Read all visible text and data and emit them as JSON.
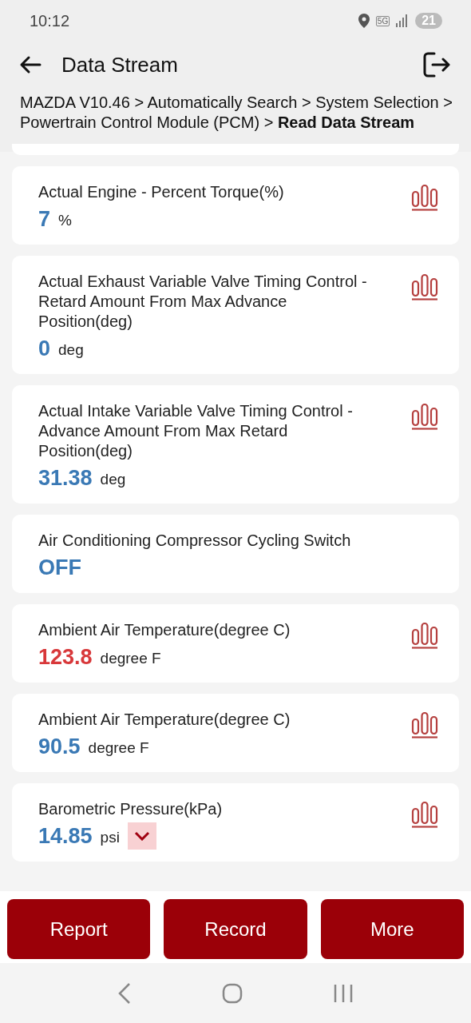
{
  "status_bar": {
    "time": "10:12",
    "network": "5G",
    "battery": "21"
  },
  "header": {
    "title": "Data Stream"
  },
  "breadcrumb": "MAZDA V10.46 > Automatically Search > System Selection > Powertrain Control Module (PCM) > **Read Data Stream**",
  "items": [
    {
      "name": "Actual Engine - Percent Torque(%)",
      "value": "7",
      "unit": "%",
      "alarm": false,
      "has_chart": true,
      "unit_dropdown": false
    },
    {
      "name": "Actual Exhaust Variable Valve Timing Control - Retard Amount From Max Advance Position(deg)",
      "value": "0",
      "unit": "deg",
      "alarm": false,
      "has_chart": true,
      "unit_dropdown": false
    },
    {
      "name": "Actual Intake Variable Valve Timing Control - Advance Amount From Max Retard Position(deg)",
      "value": "31.38",
      "unit": "deg",
      "alarm": false,
      "has_chart": true,
      "unit_dropdown": false
    },
    {
      "name": "Air Conditioning Compressor Cycling Switch",
      "value": "OFF",
      "alarm": false,
      "has_chart": false,
      "unit_dropdown": false
    },
    {
      "name": "Ambient Air Temperature(degree C)",
      "value": "123.8",
      "unit": "degree F",
      "alarm": true,
      "has_chart": true,
      "unit_dropdown": false
    },
    {
      "name": "Ambient Air Temperature(degree C)",
      "value": "90.5",
      "unit": "degree F",
      "alarm": false,
      "has_chart": true,
      "unit_dropdown": false
    },
    {
      "name": "Barometric Pressure(kPa)",
      "value": "14.85",
      "unit": "psi",
      "alarm": false,
      "has_chart": true,
      "unit_dropdown": true
    }
  ],
  "buttons": [
    "Report",
    "Record",
    "More"
  ]
}
